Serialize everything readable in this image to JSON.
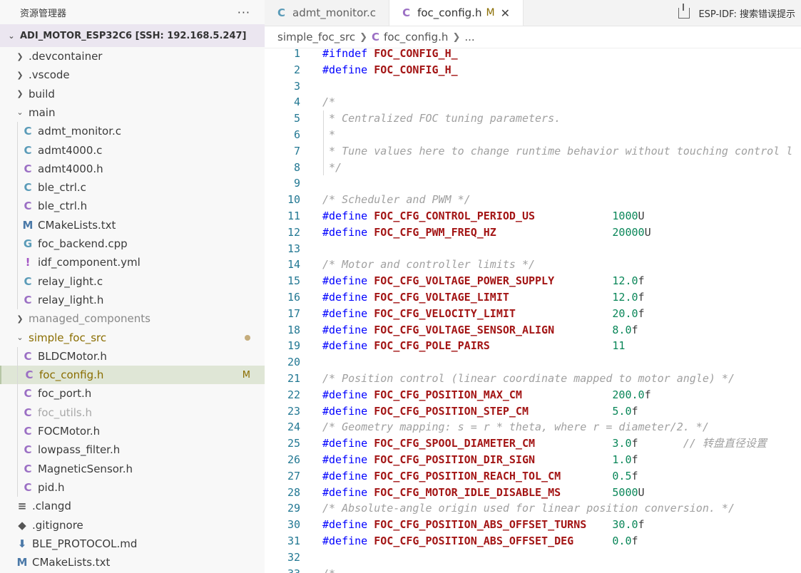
{
  "sidebar": {
    "title": "资源管理器",
    "more_label": "···",
    "root_label": "ADI_MOTOR_ESP32C6 [SSH: 192.168.5.247]",
    "items": [
      {
        "label": ".devcontainer",
        "kind": "folder",
        "state": "collapsed"
      },
      {
        "label": ".vscode",
        "kind": "folder",
        "state": "collapsed"
      },
      {
        "label": "build",
        "kind": "folder",
        "state": "collapsed"
      },
      {
        "label": "main",
        "kind": "folder",
        "state": "expanded"
      },
      {
        "label": "admt_monitor.c",
        "icon": "C",
        "kind": "c"
      },
      {
        "label": "admt4000.c",
        "icon": "C",
        "kind": "c"
      },
      {
        "label": "admt4000.h",
        "icon": "C",
        "kind": "h"
      },
      {
        "label": "ble_ctrl.c",
        "icon": "C",
        "kind": "c"
      },
      {
        "label": "ble_ctrl.h",
        "icon": "C",
        "kind": "h"
      },
      {
        "label": "CMakeLists.txt",
        "icon": "M",
        "kind": "m"
      },
      {
        "label": "foc_backend.cpp",
        "icon": "G",
        "kind": "cpp"
      },
      {
        "label": "idf_component.yml",
        "icon": "!",
        "kind": "yml"
      },
      {
        "label": "relay_light.c",
        "icon": "C",
        "kind": "c"
      },
      {
        "label": "relay_light.h",
        "icon": "C",
        "kind": "h"
      },
      {
        "label": "managed_components",
        "kind": "folder",
        "state": "collapsed"
      },
      {
        "label": "simple_foc_src",
        "kind": "folder",
        "state": "expanded"
      },
      {
        "label": "BLDCMotor.h",
        "icon": "C",
        "kind": "h"
      },
      {
        "label": "foc_config.h",
        "icon": "C",
        "kind": "h",
        "badge": "M"
      },
      {
        "label": "foc_port.h",
        "icon": "C",
        "kind": "h"
      },
      {
        "label": "foc_utils.h",
        "icon": "C",
        "kind": "h"
      },
      {
        "label": "FOCMotor.h",
        "icon": "C",
        "kind": "h"
      },
      {
        "label": "lowpass_filter.h",
        "icon": "C",
        "kind": "h"
      },
      {
        "label": "MagneticSensor.h",
        "icon": "C",
        "kind": "h"
      },
      {
        "label": "pid.h",
        "icon": "C",
        "kind": "h"
      },
      {
        "label": ".clangd",
        "icon": "≡",
        "kind": "plain"
      },
      {
        "label": ".gitignore",
        "icon": "◆",
        "kind": "git"
      },
      {
        "label": "BLE_PROTOCOL.md",
        "icon": "⬇",
        "kind": "md"
      },
      {
        "label": "CMakeLists.txt",
        "icon": "M",
        "kind": "m"
      }
    ]
  },
  "tabs": [
    {
      "icon": "C",
      "label": "admt_monitor.c",
      "active": false
    },
    {
      "icon": "C",
      "label": "foc_config.h",
      "active": true,
      "modified": "M",
      "close": "✕"
    }
  ],
  "toolbar_right": "ESP-IDF: 搜索错误提示",
  "breadcrumb": {
    "folder": "simple_foc_src",
    "file_icon": "C",
    "file": "foc_config.h",
    "more": "..."
  },
  "code_lines": [
    {
      "n": "1",
      "t": "#ifndef FOC_CONFIG_H_"
    },
    {
      "n": "2",
      "t": "#define FOC_CONFIG_H_"
    },
    {
      "n": "3",
      "t": ""
    },
    {
      "n": "4",
      "t": "/*"
    },
    {
      "n": "5",
      "t": " * Centralized FOC tuning parameters."
    },
    {
      "n": "6",
      "t": " *"
    },
    {
      "n": "7",
      "t": " * Tune values here to change runtime behavior without touching control l"
    },
    {
      "n": "8",
      "t": " */"
    },
    {
      "n": "9",
      "t": ""
    },
    {
      "n": "10",
      "t": "/* Scheduler and PWM */"
    },
    {
      "n": "11",
      "t": "#define FOC_CFG_CONTROL_PERIOD_US            1000U"
    },
    {
      "n": "12",
      "t": "#define FOC_CFG_PWM_FREQ_HZ                  20000U"
    },
    {
      "n": "13",
      "t": ""
    },
    {
      "n": "14",
      "t": "/* Motor and controller limits */"
    },
    {
      "n": "15",
      "t": "#define FOC_CFG_VOLTAGE_POWER_SUPPLY         12.0f"
    },
    {
      "n": "16",
      "t": "#define FOC_CFG_VOLTAGE_LIMIT                12.0f"
    },
    {
      "n": "17",
      "t": "#define FOC_CFG_VELOCITY_LIMIT               20.0f"
    },
    {
      "n": "18",
      "t": "#define FOC_CFG_VOLTAGE_SENSOR_ALIGN         8.0f"
    },
    {
      "n": "19",
      "t": "#define FOC_CFG_POLE_PAIRS                   11"
    },
    {
      "n": "20",
      "t": ""
    },
    {
      "n": "21",
      "t": "/* Position control (linear coordinate mapped to motor angle) */"
    },
    {
      "n": "22",
      "t": "#define FOC_CFG_POSITION_MAX_CM              200.0f"
    },
    {
      "n": "23",
      "t": "#define FOC_CFG_POSITION_STEP_CM             5.0f"
    },
    {
      "n": "24",
      "t": "/* Geometry mapping: s = r * theta, where r = diameter/2. */"
    },
    {
      "n": "25",
      "t": "#define FOC_CFG_SPOOL_DIAMETER_CM            3.0f       // 转盘直径设置"
    },
    {
      "n": "26",
      "t": "#define FOC_CFG_POSITION_DIR_SIGN            1.0f"
    },
    {
      "n": "27",
      "t": "#define FOC_CFG_POSITION_REACH_TOL_CM        0.5f"
    },
    {
      "n": "28",
      "t": "#define FOC_CFG_MOTOR_IDLE_DISABLE_MS        5000U"
    },
    {
      "n": "29",
      "t": "/* Absolute-angle origin used for linear position conversion. */"
    },
    {
      "n": "30",
      "t": "#define FOC_CFG_POSITION_ABS_OFFSET_TURNS    30.0f"
    },
    {
      "n": "31",
      "t": "#define FOC_CFG_POSITION_ABS_OFFSET_DEG      0.0f"
    },
    {
      "n": "32",
      "t": ""
    },
    {
      "n": "33",
      "t": "/*"
    }
  ]
}
